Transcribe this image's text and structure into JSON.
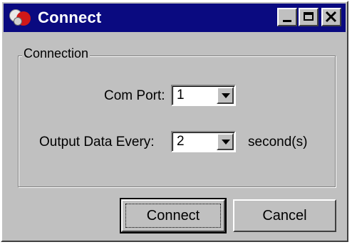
{
  "window": {
    "title": "Connect",
    "icon": "app-bubbles-icon",
    "controls": [
      "minimize-icon",
      "maximize-icon",
      "close-icon"
    ]
  },
  "group": {
    "label": "Connection"
  },
  "fields": {
    "com_port": {
      "label": "Com Port:",
      "value": "1"
    },
    "output_every": {
      "label": "Output Data Every:",
      "value": "2",
      "unit": "second(s)"
    }
  },
  "buttons": {
    "connect": "Connect",
    "cancel": "Cancel"
  },
  "colors": {
    "titlebar": "#0a0a80",
    "face": "#c0c0c0",
    "accent_icon": "#d01818"
  }
}
